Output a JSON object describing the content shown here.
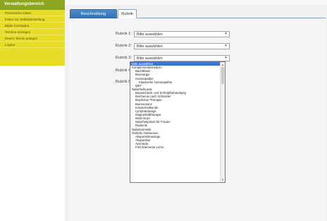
{
  "sidebar": {
    "title": "Verwaltungsbereich",
    "items": [
      {
        "label": "Persönliche Daten"
      },
      {
        "label": "Daten zur Selbstdarstellung"
      },
      {
        "label": "Bilder hochladen"
      },
      {
        "label": "Termine anzeigen"
      },
      {
        "label": "Neuen Termin anlegen"
      },
      {
        "label": "Logout"
      }
    ]
  },
  "tabs": [
    {
      "label": "Beschreibung"
    },
    {
      "label": "Rubrik"
    }
  ],
  "rubriken": [
    {
      "label": "Rubrik 1:",
      "value": "Bitte auswählen"
    },
    {
      "label": "Rubrik 2:",
      "value": "Bitte auswählen"
    },
    {
      "label": "Rubrik 3:",
      "value": "Bitte auswählen"
    },
    {
      "label": "Rubrik 4:",
      "value": ""
    },
    {
      "label": "Rubrik 5:",
      "value": ""
    }
  ],
  "dropdown": {
    "options": [
      {
        "label": "Bitte auswählen",
        "level": 0,
        "selected": true
      },
      {
        "label": "Komplementärmedizin",
        "level": 0
      },
      {
        "label": "Bachblüten",
        "level": 1
      },
      {
        "label": "Bioenergie",
        "level": 1
      },
      {
        "label": "Homöopathie",
        "level": 1
      },
      {
        "label": "Klassische Homöopathie",
        "level": 2
      },
      {
        "label": "MET",
        "level": 1
      },
      {
        "label": "Naturheilkunde",
        "level": 0
      },
      {
        "label": "Baunscheidt- und Schröpfbehandlung",
        "level": 1
      },
      {
        "label": "Biochemie nach Schüssler",
        "level": 1
      },
      {
        "label": "Biophoton-Therapie",
        "level": 1
      },
      {
        "label": "Bioresonanz",
        "level": 1
      },
      {
        "label": "Kräuterheilkunde",
        "level": 1
      },
      {
        "label": "Lymphdrainage",
        "level": 1
      },
      {
        "label": "Magnetfeldtherapie",
        "level": 1
      },
      {
        "label": "Meta-Scan",
        "level": 1
      },
      {
        "label": "Naturheilpraxis für Frauen",
        "level": 1
      },
      {
        "label": "Radionik",
        "level": 1
      },
      {
        "label": "Naturkosmetik",
        "level": 0
      },
      {
        "label": "Östliche Heilweisen",
        "level": 0
      },
      {
        "label": "Akupunktmassage",
        "level": 1
      },
      {
        "label": "Akupunktur",
        "level": 1
      },
      {
        "label": "Ayurveda",
        "level": 1
      },
      {
        "label": "Fünf-Elemente-Lehre",
        "level": 1
      }
    ]
  },
  "colors": {
    "sidebar_bg": "#e8dc2a",
    "sidebar_title_bg": "#8aa51e",
    "active_tab": "#3a7bbf",
    "selected_option": "#3875d7"
  }
}
